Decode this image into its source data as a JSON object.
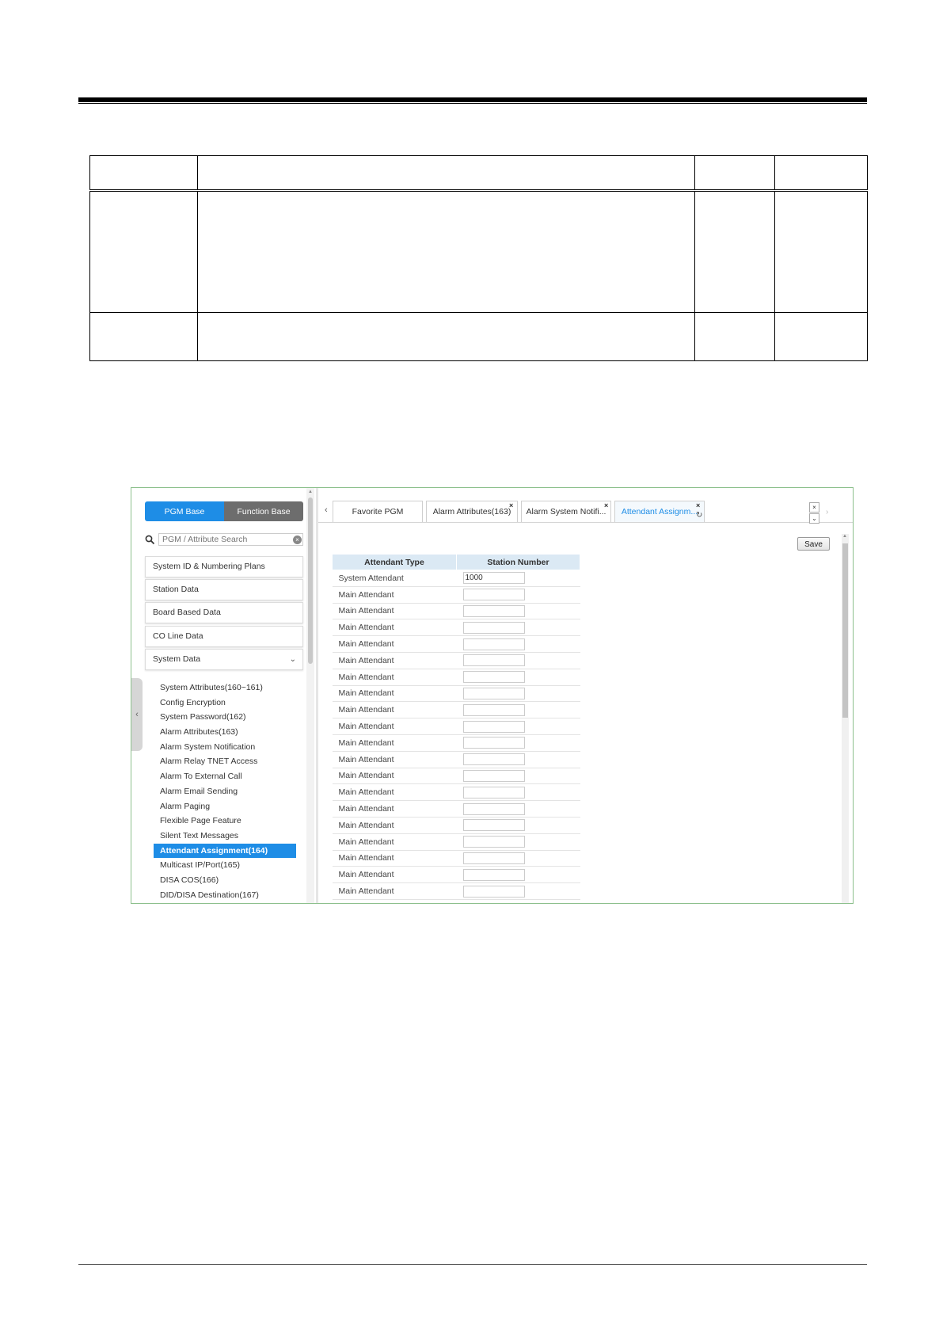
{
  "screenshot": {
    "base_toggle": {
      "pgm_base": "PGM Base",
      "function_base": "Function Base"
    },
    "search": {
      "placeholder": "PGM / Attribute Search"
    },
    "menu": [
      {
        "label": "System ID & Numbering Plans"
      },
      {
        "label": "Station Data"
      },
      {
        "label": "Board Based Data"
      },
      {
        "label": "CO Line Data"
      },
      {
        "label": "System Data"
      }
    ],
    "sub_items": [
      "System Attributes(160~161)",
      "Config Encryption",
      "System Password(162)",
      "Alarm Attributes(163)",
      "Alarm System Notification",
      "Alarm Relay TNET Access",
      "Alarm To External Call",
      "Alarm Email Sending",
      "Alarm Paging",
      "Flexible Page Feature",
      "Silent Text Messages",
      "Attendant Assignment(164)",
      "Multicast IP/Port(165)",
      "DISA COS(166)",
      "DID/DISA Destination(167)"
    ],
    "active_sub_item": "Attendant Assignment(164)",
    "tabs": [
      {
        "label": "Favorite PGM"
      },
      {
        "label": "Alarm Attributes(163)"
      },
      {
        "label": "Alarm System Notifi..."
      },
      {
        "label": "Attendant Assignm..."
      }
    ],
    "save_label": "Save",
    "table": {
      "headers": [
        "Attendant Type",
        "Station Number"
      ],
      "rows": [
        {
          "type": "System Attendant",
          "number": "1000"
        },
        {
          "type": "Main Attendant",
          "number": ""
        },
        {
          "type": "Main Attendant",
          "number": ""
        },
        {
          "type": "Main Attendant",
          "number": ""
        },
        {
          "type": "Main Attendant",
          "number": ""
        },
        {
          "type": "Main Attendant",
          "number": ""
        },
        {
          "type": "Main Attendant",
          "number": ""
        },
        {
          "type": "Main Attendant",
          "number": ""
        },
        {
          "type": "Main Attendant",
          "number": ""
        },
        {
          "type": "Main Attendant",
          "number": ""
        },
        {
          "type": "Main Attendant",
          "number": ""
        },
        {
          "type": "Main Attendant",
          "number": ""
        },
        {
          "type": "Main Attendant",
          "number": ""
        },
        {
          "type": "Main Attendant",
          "number": ""
        },
        {
          "type": "Main Attendant",
          "number": ""
        },
        {
          "type": "Main Attendant",
          "number": ""
        },
        {
          "type": "Main Attendant",
          "number": ""
        },
        {
          "type": "Main Attendant",
          "number": ""
        },
        {
          "type": "Main Attendant",
          "number": ""
        },
        {
          "type": "Main Attendant",
          "number": ""
        }
      ]
    }
  }
}
